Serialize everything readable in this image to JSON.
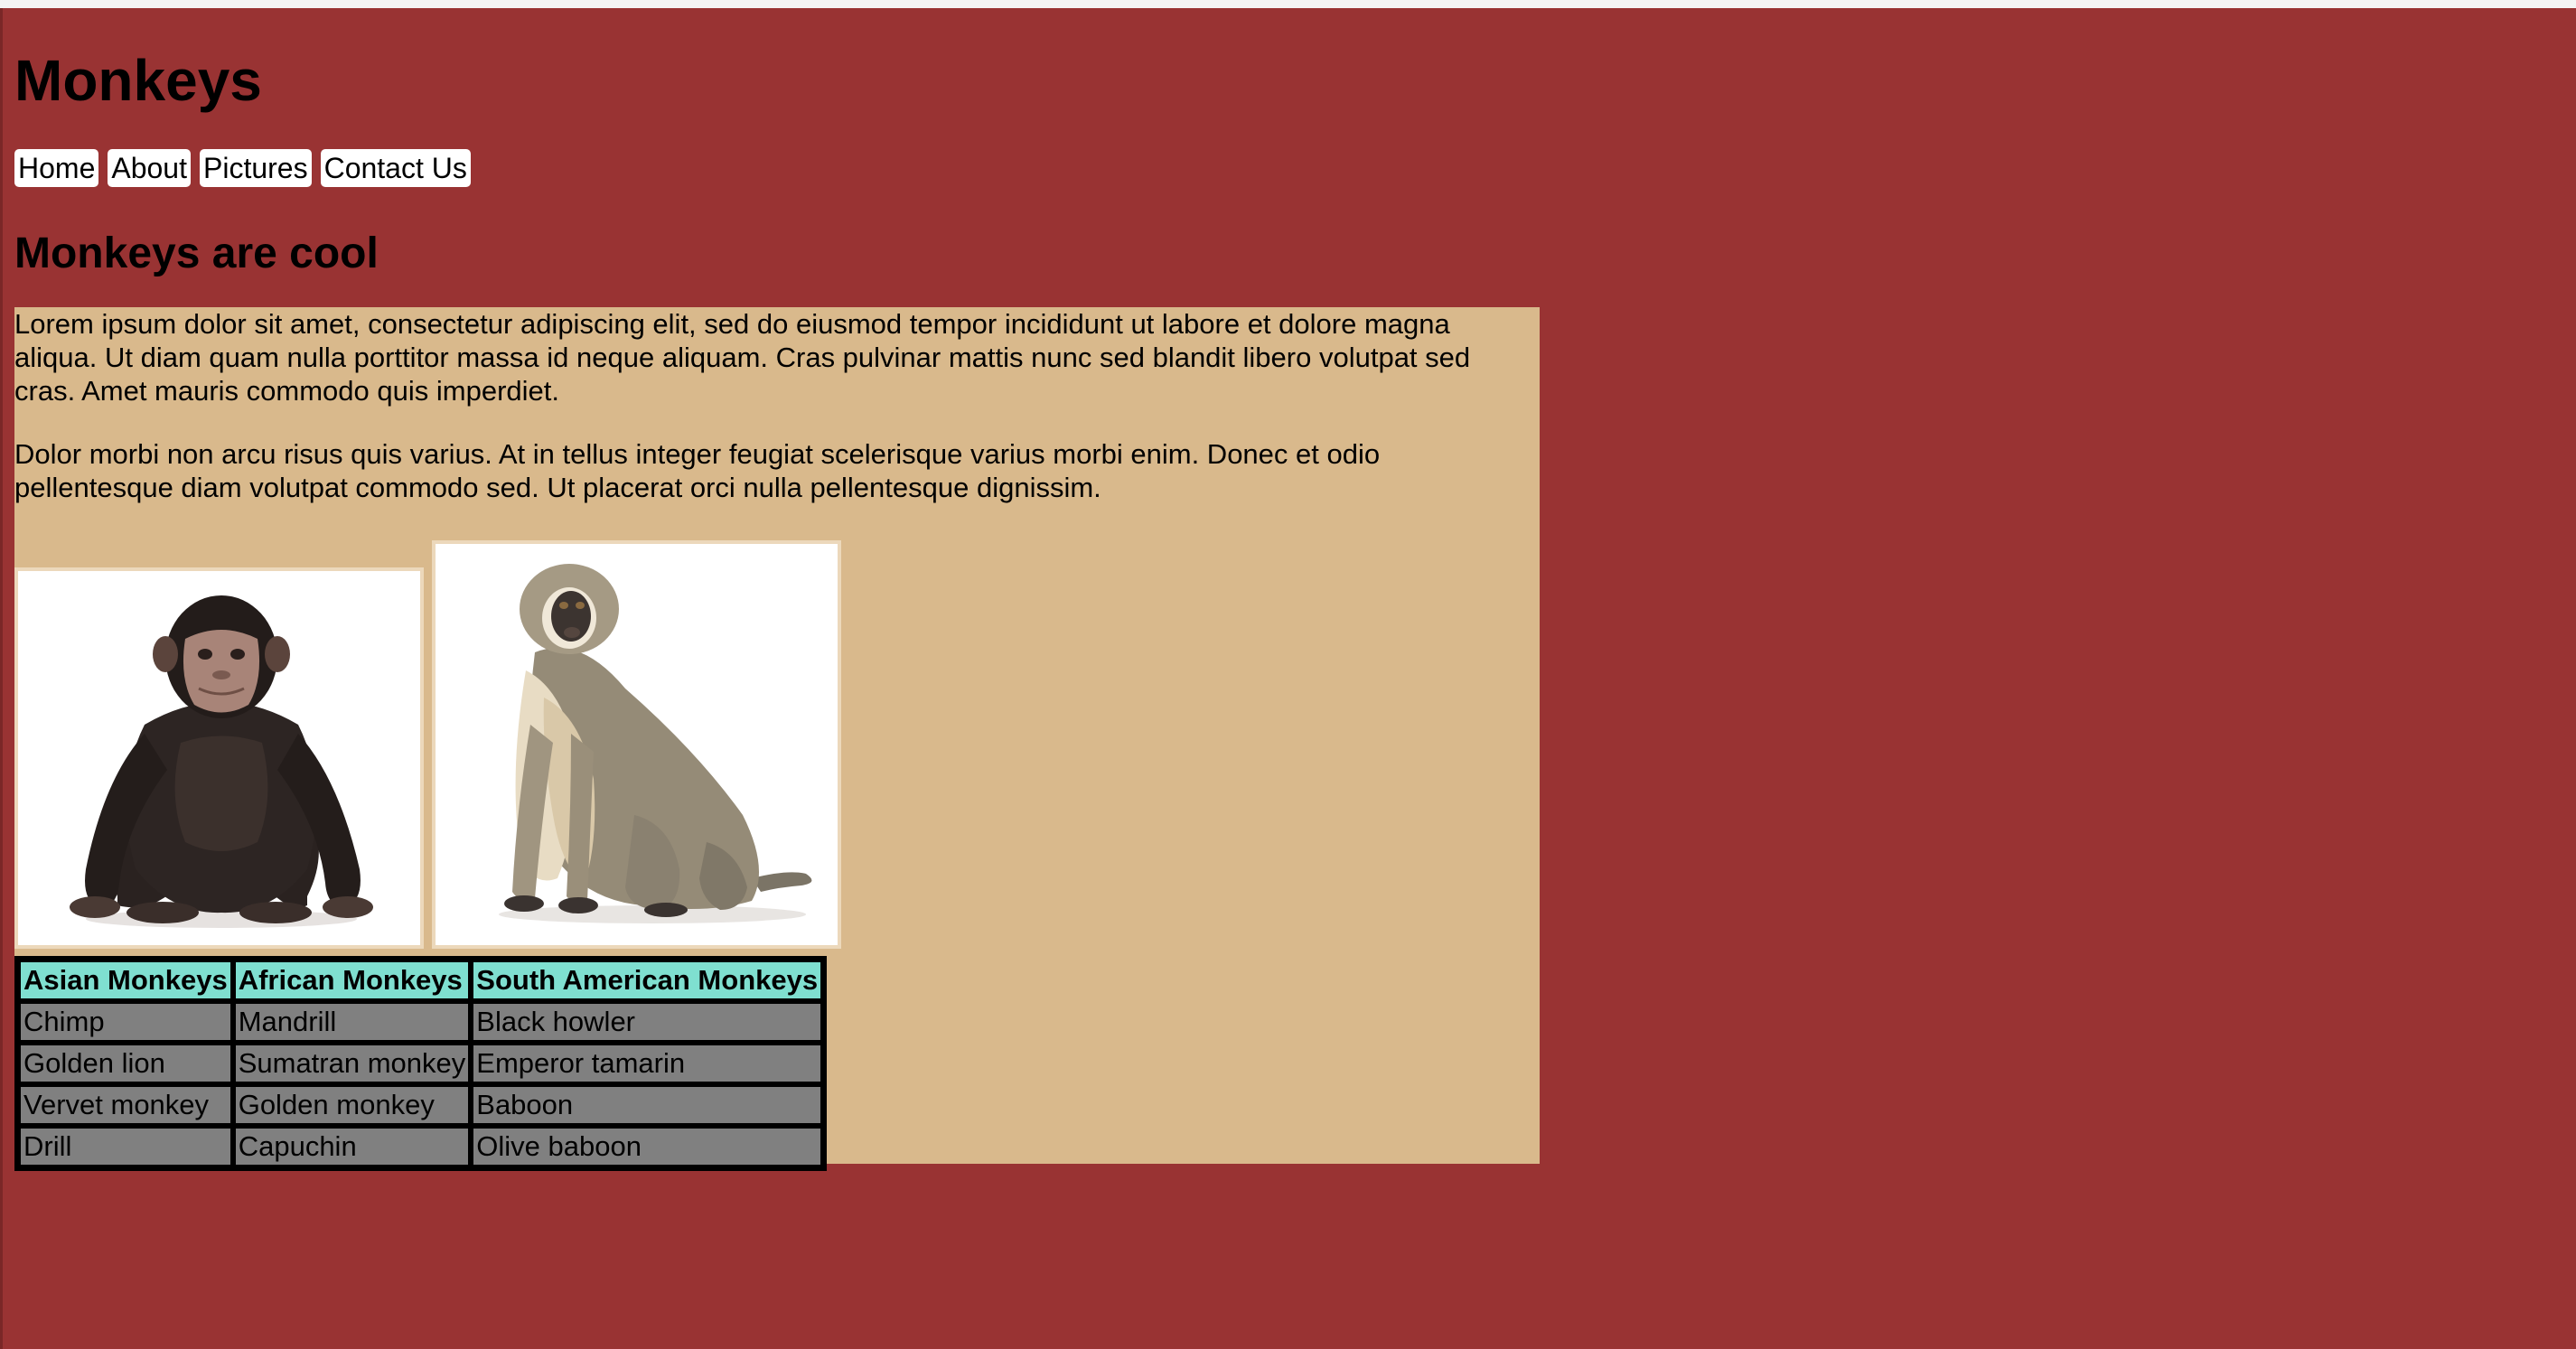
{
  "header": {
    "title": "Monkeys"
  },
  "nav": {
    "items": [
      {
        "label": "Home"
      },
      {
        "label": "About"
      },
      {
        "label": "Pictures"
      },
      {
        "label": "Contact Us"
      }
    ]
  },
  "main": {
    "heading": "Monkeys are cool",
    "paragraphs": [
      "Lorem ipsum dolor sit amet, consectetur adipiscing elit, sed do eiusmod tempor incididunt ut labore et dolore magna aliqua. Ut diam quam nulla porttitor massa id neque aliquam. Cras pulvinar mattis nunc sed blandit libero volutpat sed cras. Amet mauris commodo quis imperdiet.",
      "Dolor morbi non arcu risus quis varius. At in tellus integer feugiat scelerisque varius morbi enim. Donec et odio pellentesque diam volutpat commodo sed. Ut placerat orci nulla pellentesque dignissim."
    ],
    "images": [
      {
        "name": "chimpanzee-photo"
      },
      {
        "name": "vervet-monkey-photo"
      }
    ],
    "table": {
      "headers": [
        "Asian Monkeys",
        "African Monkeys",
        "South American Monkeys"
      ],
      "rows": [
        [
          "Chimp",
          "Mandrill",
          "Black howler"
        ],
        [
          "Golden lion",
          "Sumatran monkey",
          "Emperor tamarin"
        ],
        [
          "Vervet monkey",
          "Golden monkey",
          "Baboon"
        ],
        [
          "Drill",
          "Capuchin",
          "Olive baboon"
        ]
      ]
    }
  },
  "colors": {
    "page_background": "#993333",
    "content_background": "#d9b98c",
    "table_header": "#7fdfd0",
    "table_cell": "#808080",
    "nav_background": "#ffffff"
  }
}
